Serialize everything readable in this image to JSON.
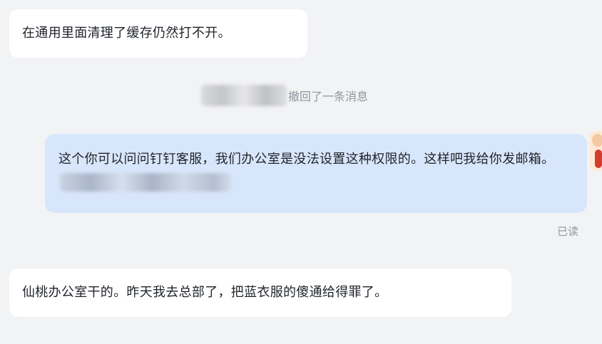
{
  "messages": {
    "incoming_1": "在通用里面清理了缓存仍然打不开。",
    "recall_notice": "撤回了一条消息",
    "outgoing_1": "这个你可以问问钉钉客服，我们办公室是没法设置这种权限的。这样吧我给你发邮箱。",
    "read_status": "已读",
    "incoming_2": "仙桃办公室干的。昨天我去总部了，把蓝衣服的傻通给得罪了。"
  },
  "colors": {
    "background": "#f2f3f5",
    "incoming_bubble": "#ffffff",
    "outgoing_bubble": "#d8e6fb",
    "muted_text": "#8f959e"
  }
}
